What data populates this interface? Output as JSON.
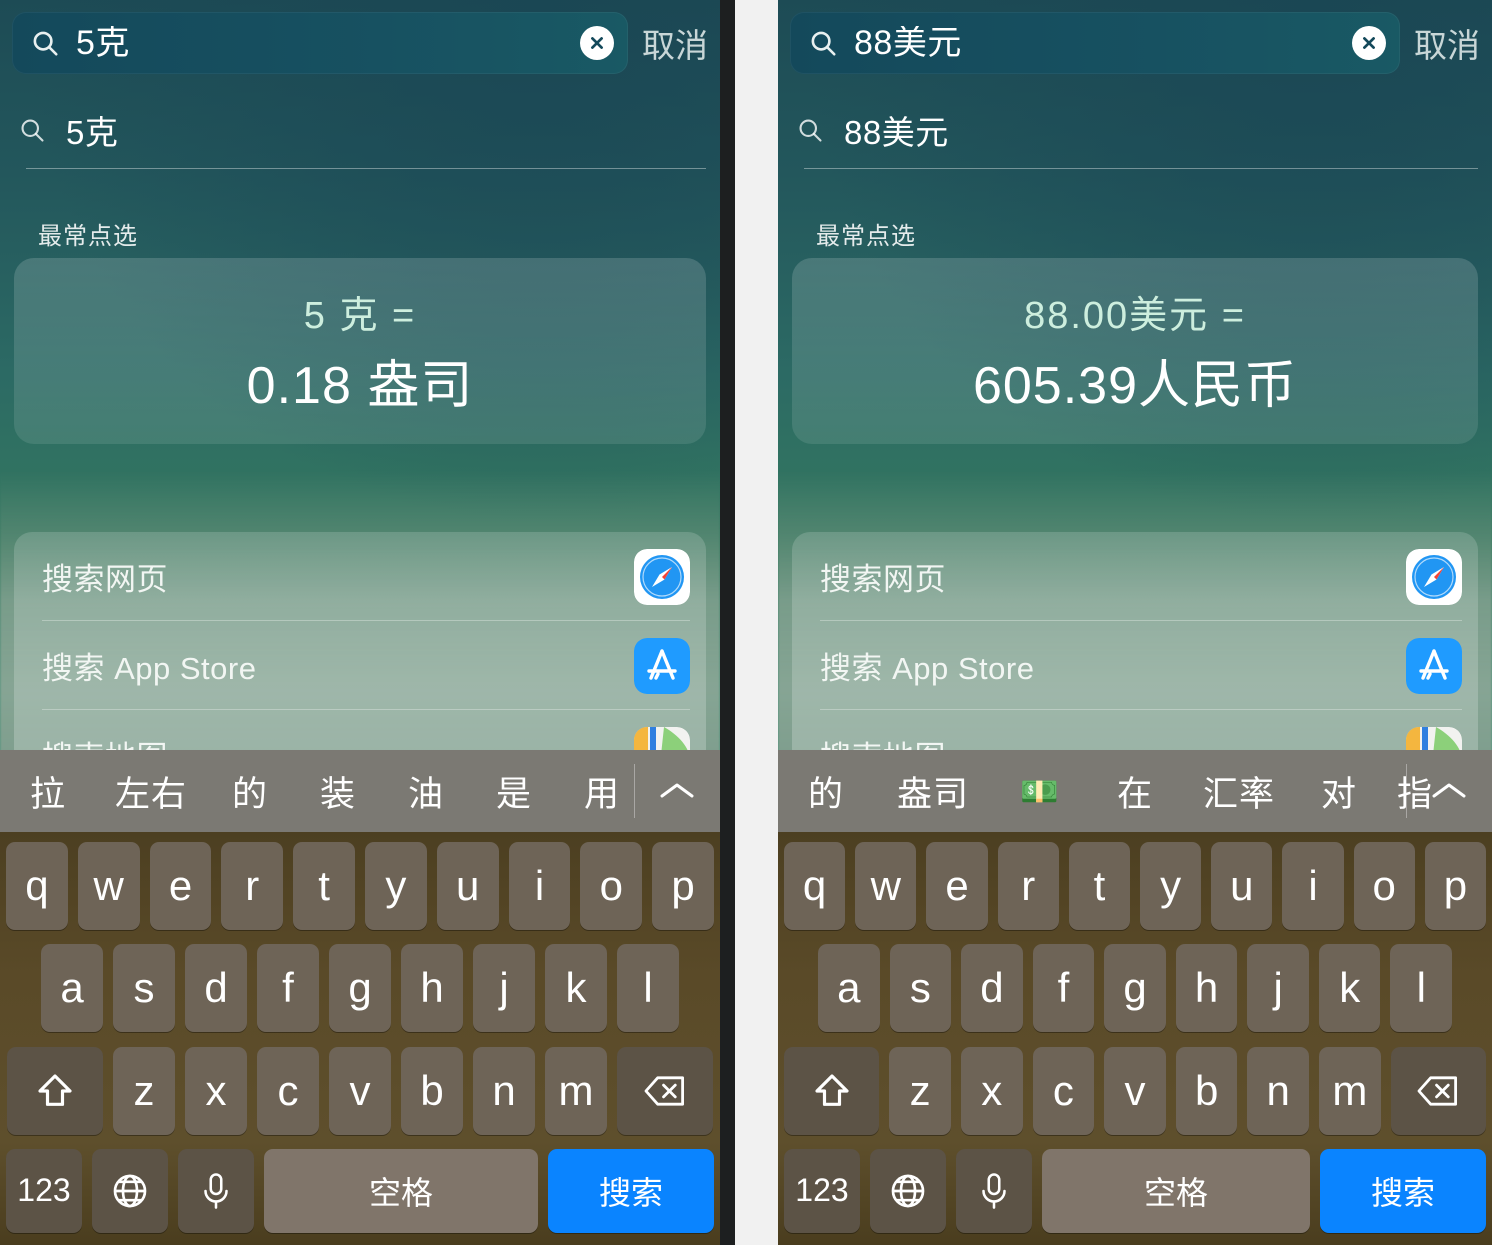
{
  "panels": [
    {
      "id": "left",
      "search": {
        "query": "5克",
        "icon": "search-icon",
        "clear_icon": "clear-circle-icon",
        "cancel_label": "取消"
      },
      "echo_suggestion": {
        "icon": "search-icon",
        "text": "5克"
      },
      "section_title": "最常点选",
      "conversion_card": {
        "from": "5 克 =",
        "to": "0.18 盎司"
      },
      "results": [
        {
          "label": "搜索网页",
          "icon": "safari-icon"
        },
        {
          "label": "搜索 App Store",
          "icon": "app-store-icon"
        },
        {
          "label": "搜索地图",
          "icon": "maps-icon"
        }
      ],
      "keyboard": {
        "candidates": [
          "拉",
          "左右",
          "的",
          "装",
          "油",
          "是",
          "用"
        ],
        "expand_icon": "chevron-up-icon",
        "row1": [
          "q",
          "w",
          "e",
          "r",
          "t",
          "y",
          "u",
          "i",
          "o",
          "p"
        ],
        "row2": [
          "a",
          "s",
          "d",
          "f",
          "g",
          "h",
          "j",
          "k",
          "l"
        ],
        "row3": [
          "z",
          "x",
          "c",
          "v",
          "b",
          "n",
          "m"
        ],
        "shift_icon": "shift-icon",
        "backspace_icon": "backspace-icon",
        "numbers_label": "123",
        "globe_icon": "globe-icon",
        "mic_icon": "microphone-icon",
        "space_label": "空格",
        "go_label": "搜索"
      }
    },
    {
      "id": "right",
      "search": {
        "query": "88美元",
        "icon": "search-icon",
        "clear_icon": "clear-circle-icon",
        "cancel_label": "取消"
      },
      "echo_suggestion": {
        "icon": "search-icon",
        "text": "88美元"
      },
      "section_title": "最常点选",
      "conversion_card": {
        "from": "88.00美元 =",
        "to": "605.39人民币"
      },
      "results": [
        {
          "label": "搜索网页",
          "icon": "safari-icon"
        },
        {
          "label": "搜索 App Store",
          "icon": "app-store-icon"
        },
        {
          "label": "搜索地图",
          "icon": "maps-icon"
        }
      ],
      "keyboard": {
        "candidates": [
          "的",
          "盎司",
          "💵",
          "在",
          "汇率",
          "对",
          "指"
        ],
        "expand_icon": "chevron-up-icon",
        "row1": [
          "q",
          "w",
          "e",
          "r",
          "t",
          "y",
          "u",
          "i",
          "o",
          "p"
        ],
        "row2": [
          "a",
          "s",
          "d",
          "f",
          "g",
          "h",
          "j",
          "k",
          "l"
        ],
        "row3": [
          "z",
          "x",
          "c",
          "v",
          "b",
          "n",
          "m"
        ],
        "shift_icon": "shift-icon",
        "backspace_icon": "backspace-icon",
        "numbers_label": "123",
        "globe_icon": "globe-icon",
        "mic_icon": "microphone-icon",
        "space_label": "空格",
        "go_label": "搜索"
      }
    }
  ],
  "colors": {
    "accent_blue": "#0a84ff",
    "search_field_bg": "#175161",
    "bg_top": "#1d4b55",
    "bg_mid": "#3d8a72",
    "keyboard_bg": "#5a4a28",
    "key_bg": "#6e6457",
    "candidate_bar_bg": "#7b7973"
  }
}
